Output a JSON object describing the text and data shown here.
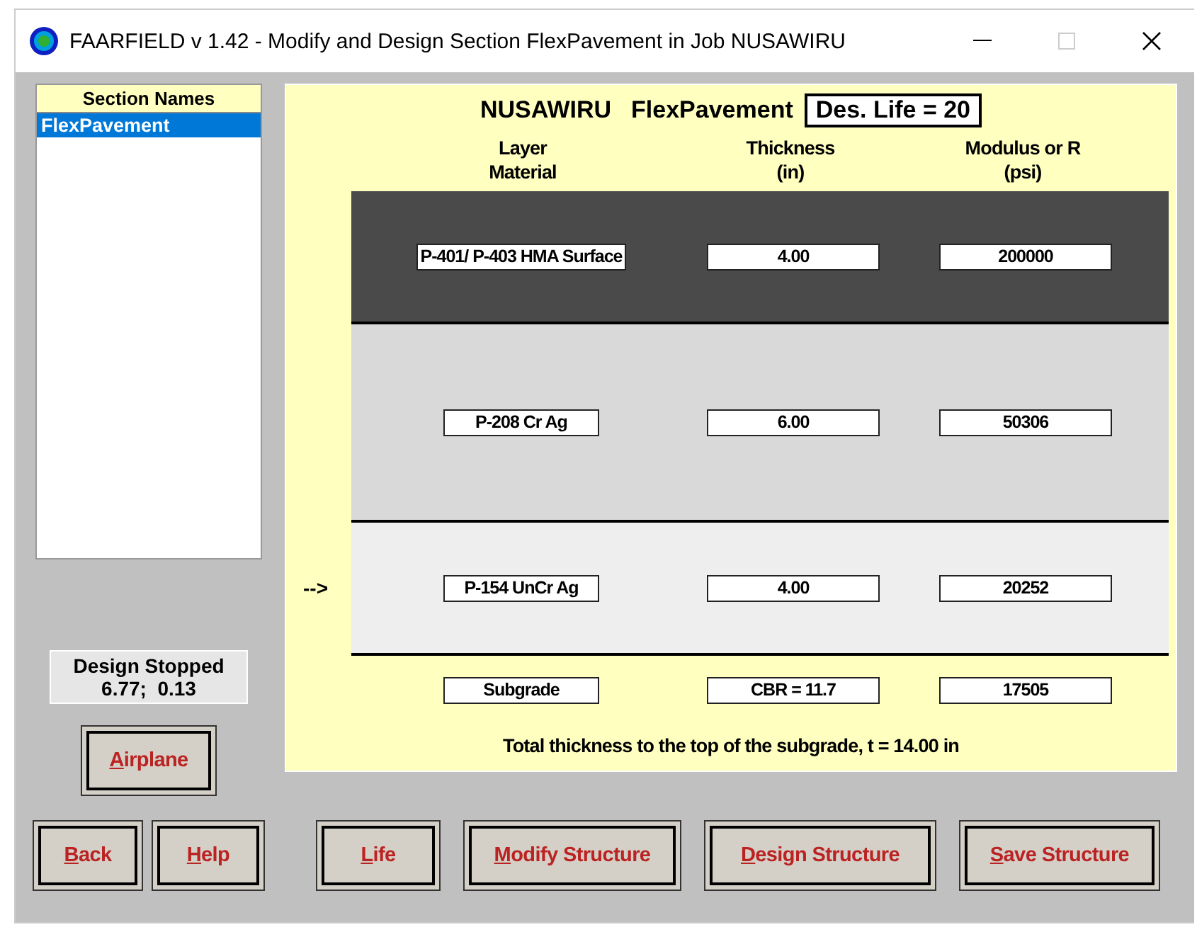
{
  "window": {
    "title": "FAARFIELD v 1.42 - Modify and Design Section FlexPavement in Job NUSAWIRU"
  },
  "section_list": {
    "header": "Section Names",
    "items": [
      {
        "label": "FlexPavement",
        "selected": true
      }
    ]
  },
  "design_status": {
    "title": "Design Stopped",
    "values": "6.77;  0.13"
  },
  "panel": {
    "job": "NUSAWIRU",
    "section": "FlexPavement",
    "des_life": "Des. Life = 20",
    "columns": [
      "Layer\nMaterial",
      "Thickness\n(in)",
      "Modulus or R\n(psi)"
    ],
    "layers": [
      {
        "kind": "layer",
        "color": "#4a4a4a",
        "material": "P-401/ P-403 HMA Surface",
        "thickness": "4.00",
        "modulus": "200000"
      },
      {
        "kind": "layer",
        "color": "#d9d9d9",
        "material": "P-208 Cr Ag",
        "thickness": "6.00",
        "modulus": "50306"
      },
      {
        "kind": "layer",
        "color": "#eeeeee",
        "material": "P-154 UnCr Ag",
        "thickness": "4.00",
        "modulus": "20252",
        "marker": "-->"
      },
      {
        "kind": "subgrade",
        "material": "Subgrade",
        "thickness": "CBR = 11.7",
        "modulus": "17505"
      }
    ],
    "total": "Total thickness to the top of the subgrade, t = 14.00 in"
  },
  "airplane_button": "Airplane",
  "buttons": [
    "Back",
    "Help",
    "Life",
    "Modify Structure",
    "Design Structure",
    "Save Structure"
  ]
}
